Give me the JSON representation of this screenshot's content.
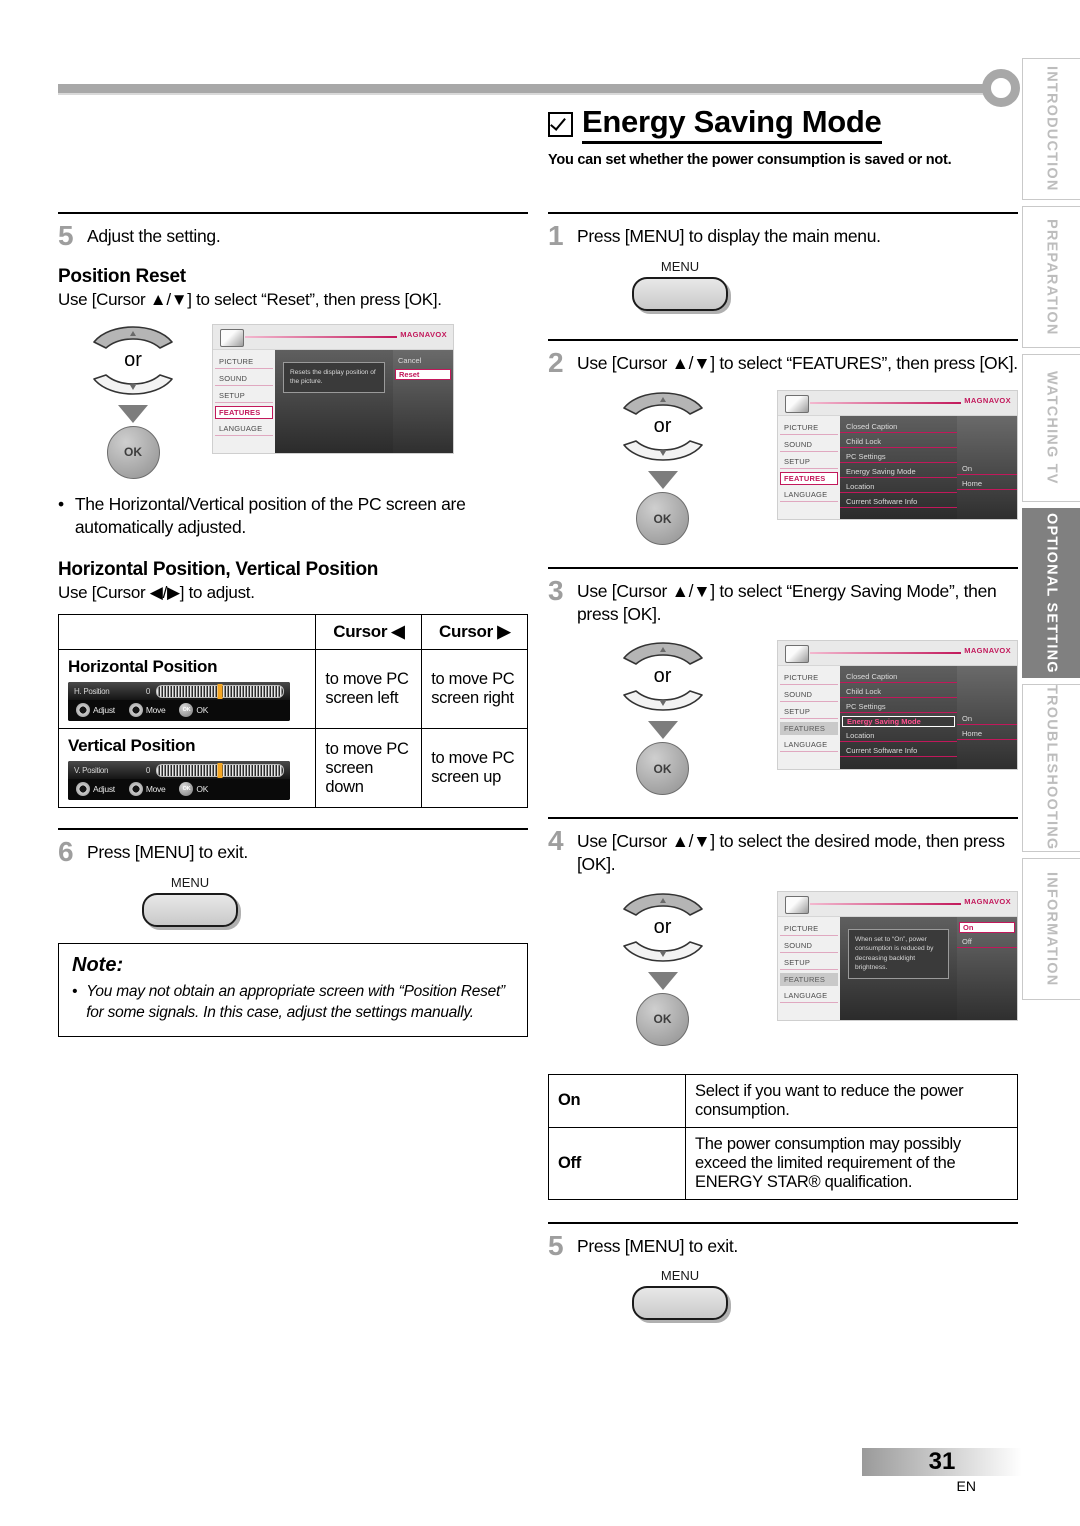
{
  "heading": {
    "title": "Energy Saving Mode",
    "subtitle": "You can set whether the power consumption is saved or not.",
    "checkbox_icon": "checkbox-checked-icon"
  },
  "side_tabs": [
    {
      "label": "INTRODUCTION",
      "active": false
    },
    {
      "label": "PREPARATION",
      "active": false
    },
    {
      "label": "WATCHING TV",
      "active": false
    },
    {
      "label": "OPTIONAL SETTING",
      "active": true
    },
    {
      "label": "TROUBLESHOOTING",
      "active": false
    },
    {
      "label": "INFORMATION",
      "active": false
    }
  ],
  "left_column": {
    "step5": {
      "number": "5",
      "text": "Adjust the setting.",
      "position_reset": {
        "heading": "Position Reset",
        "instruction": "Use [Cursor ▲/▼] to select “Reset”, then press [OK].",
        "or_label": "or",
        "ok_label": "OK"
      },
      "osd": {
        "brand": "MAGNAVOX",
        "menu_items": [
          "PICTURE",
          "SOUND",
          "SETUP",
          "FEATURES",
          "LANGUAGE"
        ],
        "selected_menu": "FEATURES",
        "tooltip": "Resets the display position of the picture.",
        "options": [
          "Cancel",
          "Reset"
        ],
        "selected_option": "Reset"
      },
      "bullet": "The Horizontal/Vertical position of the PC screen are automatically adjusted."
    },
    "hv_position": {
      "heading": "Horizontal Position, Vertical Position",
      "instruction": "Use [Cursor ◀/▶] to adjust.",
      "table": {
        "headers": [
          "",
          "Cursor ◀",
          "Cursor ▶"
        ],
        "rows": [
          {
            "label": "Horizontal Position",
            "slider": {
              "name": "H. Position",
              "value": "0",
              "hints": [
                "Adjust",
                "Move",
                "OK"
              ]
            },
            "left_action": "to move PC screen left",
            "right_action": "to move PC screen right"
          },
          {
            "label": "Vertical Position",
            "slider": {
              "name": "V. Position",
              "value": "0",
              "hints": [
                "Adjust",
                "Move",
                "OK"
              ]
            },
            "left_action": "to move PC screen down",
            "right_action": "to move PC screen up"
          }
        ]
      }
    },
    "step6": {
      "number": "6",
      "text": "Press [MENU] to exit.",
      "key_label": "MENU"
    },
    "note": {
      "title": "Note:",
      "items": [
        "You may not obtain an appropriate screen with “Position Reset” for some signals. In this case, adjust the settings manually."
      ]
    }
  },
  "right_column": {
    "step1": {
      "number": "1",
      "text": "Press [MENU] to display the main menu.",
      "key_label": "MENU"
    },
    "step2": {
      "number": "2",
      "text": "Use [Cursor ▲/▼] to select “FEATURES”, then press [OK].",
      "or_label": "or",
      "ok_label": "OK",
      "osd": {
        "brand": "MAGNAVOX",
        "menu_items": [
          "PICTURE",
          "SOUND",
          "SETUP",
          "FEATURES",
          "LANGUAGE"
        ],
        "selected_menu": "FEATURES",
        "sub_items": [
          "Closed Caption",
          "Child Lock",
          "PC Settings",
          "Energy Saving Mode",
          "Location",
          "Current Software Info"
        ],
        "selected_sub": "",
        "values": [
          "",
          "",
          "",
          "On",
          "Home",
          ""
        ]
      }
    },
    "step3": {
      "number": "3",
      "text": "Use [Cursor ▲/▼] to select “Energy Saving Mode”, then press [OK].",
      "or_label": "or",
      "ok_label": "OK",
      "osd": {
        "brand": "MAGNAVOX",
        "menu_items": [
          "PICTURE",
          "SOUND",
          "SETUP",
          "FEATURES",
          "LANGUAGE"
        ],
        "selected_menu": "FEATURES",
        "sub_items": [
          "Closed Caption",
          "Child Lock",
          "PC Settings",
          "Energy Saving Mode",
          "Location",
          "Current Software Info"
        ],
        "selected_sub": "Energy Saving Mode",
        "values": [
          "",
          "",
          "",
          "On",
          "Home",
          ""
        ]
      }
    },
    "step4": {
      "number": "4",
      "text": "Use [Cursor ▲/▼] to select the desired mode, then press [OK].",
      "or_label": "or",
      "ok_label": "OK",
      "osd": {
        "brand": "MAGNAVOX",
        "menu_items": [
          "PICTURE",
          "SOUND",
          "SETUP",
          "FEATURES",
          "LANGUAGE"
        ],
        "selected_menu": "FEATURES",
        "tooltip": "When set to “On”, power consumption is reduced by decreasing backlight brightness.",
        "options": [
          "On",
          "Off"
        ],
        "selected_option": "On"
      },
      "table": {
        "rows": [
          {
            "mode": "On",
            "description": "Select if you want to reduce the power consumption."
          },
          {
            "mode": "Off",
            "description": "The power consumption may possibly exceed the limited requirement of the ENERGY STAR® qualification."
          }
        ]
      }
    },
    "step5": {
      "number": "5",
      "text": "Press [MENU] to exit.",
      "key_label": "MENU"
    }
  },
  "footer": {
    "page_number": "31",
    "language_code": "EN"
  }
}
